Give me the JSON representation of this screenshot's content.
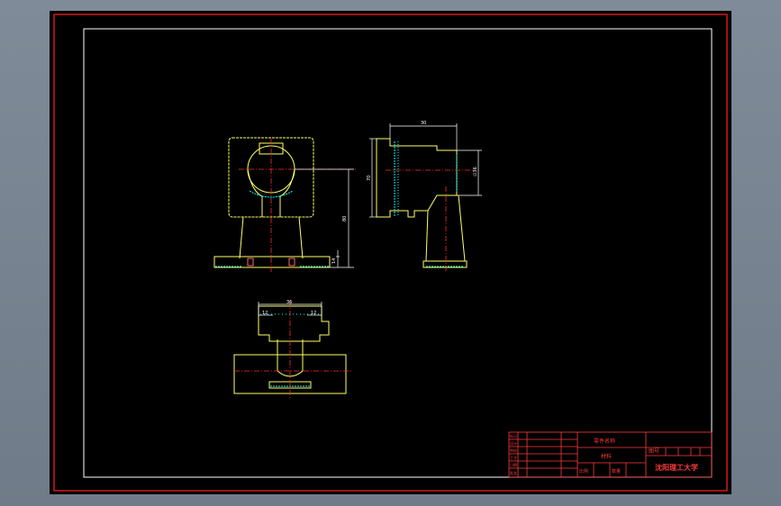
{
  "colors": {
    "background": "#000000",
    "frame": "#d41919",
    "border": "#ffffff",
    "part_outline": "#ffff66",
    "dimension": "#ffffff",
    "center_line": "#ff2a2a",
    "hatching": "#00ffff",
    "title_block_text": "#ff3b3b"
  },
  "dimensions": {
    "front_height_total": "80",
    "front_base_thickness": "14",
    "side_top_width": "30",
    "side_overall_height": "70",
    "side_bore_height": "∅36",
    "bottom_overall_width": "36",
    "bottom_left_slot": "12",
    "bottom_right_slot": "12"
  },
  "title_block": {
    "part_name": "零件名称",
    "material": "材料",
    "scale_label": "比例",
    "quantity_label": "数量",
    "drawing_number": "图号",
    "university": "沈阳理工大学",
    "left_labels": [
      "标记",
      "设计",
      "审核",
      "工艺",
      "日期",
      "批准"
    ]
  }
}
